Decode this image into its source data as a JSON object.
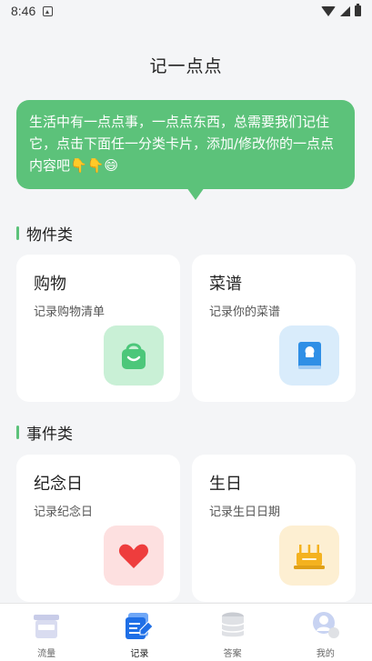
{
  "status_bar": {
    "time": "8:46"
  },
  "page": {
    "title": "记一点点"
  },
  "intro": {
    "text": "生活中有一点点事，一点点东西，总需要我们记住它，点击下面任一分类卡片，添加/修改你的一点点内容吧👇👇😄"
  },
  "sections": [
    {
      "title": "物件类",
      "cards": [
        {
          "title": "购物",
          "subtitle": "记录购物清单",
          "icon": "shopping-bag-icon",
          "tile_color": "#c9f0d6",
          "icon_color": "#4cc77a"
        },
        {
          "title": "菜谱",
          "subtitle": "记录你的菜谱",
          "icon": "recipe-book-icon",
          "tile_color": "#d9ecfb",
          "icon_color": "#2f8fe6"
        }
      ]
    },
    {
      "title": "事件类",
      "cards": [
        {
          "title": "纪念日",
          "subtitle": "记录纪念日",
          "icon": "heart-icon",
          "tile_color": "#fde0e0",
          "icon_color": "#ee3d3d"
        },
        {
          "title": "生日",
          "subtitle": "记录生日日期",
          "icon": "birthday-cake-icon",
          "tile_color": "#fdefd2",
          "icon_color": "#f4b21f"
        }
      ]
    }
  ],
  "tabs": [
    {
      "label": "流量",
      "icon": "jar-icon",
      "active": false
    },
    {
      "label": "记录",
      "icon": "notes-icon",
      "active": true
    },
    {
      "label": "答案",
      "icon": "database-icon",
      "active": false
    },
    {
      "label": "我的",
      "icon": "user-icon",
      "active": false
    }
  ]
}
